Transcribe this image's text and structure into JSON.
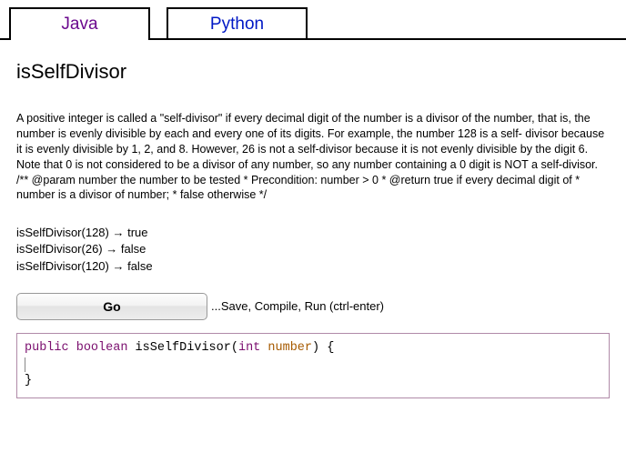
{
  "tabs": {
    "java": "Java",
    "python": "Python"
  },
  "title": "isSelfDivisor",
  "description": "A positive integer is called a \"self-divisor\" if every decimal digit of the number is a divisor of the number, that is, the number is evenly divisible by each and every one of its digits. For example, the number 128 is a self- divisor because it is evenly divisible by 1, 2, and 8. However, 26 is not a self-divisor because it is not evenly divisible by the digit 6. Note that 0 is not considered to be a divisor of any number, so any number containing a 0 digit is NOT a self-divisor. /** @param number the number to be tested * Precondition: number > 0 * @return true if every decimal digit of * number is a divisor of number; * false otherwise */",
  "examples": [
    "isSelfDivisor(128) → true",
    "isSelfDivisor(26) → false",
    "isSelfDivisor(120) → false"
  ],
  "go_button": "Go",
  "go_hint": "...Save, Compile, Run (ctrl-enter)",
  "code": {
    "kw_public": "public",
    "kw_boolean": "boolean",
    "fn_name": "isSelfDivisor",
    "open_paren": "(",
    "kw_int": "int",
    "param": "number",
    "close": ") {",
    "close_brace": "}"
  }
}
